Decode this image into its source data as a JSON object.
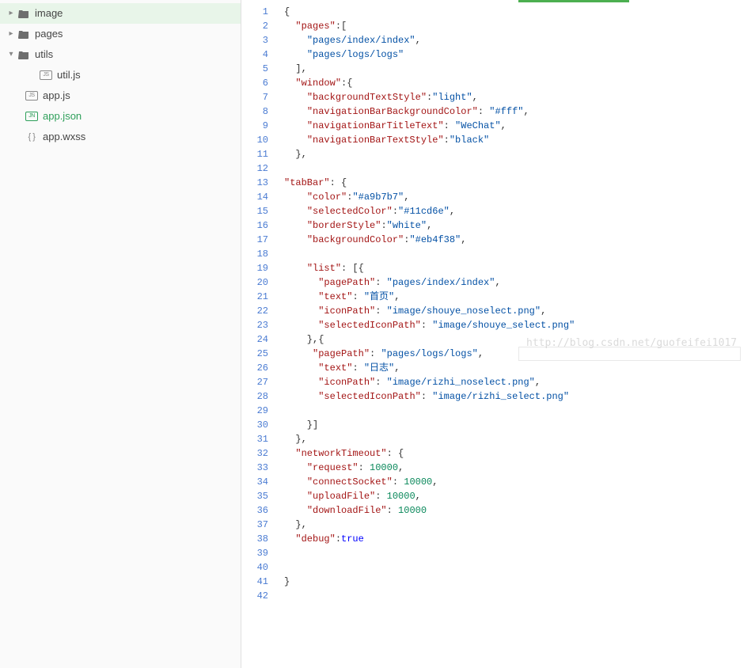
{
  "sidebar": {
    "items": [
      {
        "label": "image",
        "type": "folder",
        "indent": 0,
        "expanded": false
      },
      {
        "label": "pages",
        "type": "folder",
        "indent": 0,
        "expanded": false
      },
      {
        "label": "utils",
        "type": "folder",
        "indent": 0,
        "expanded": true
      },
      {
        "label": "util.js",
        "type": "js",
        "indent": 1
      },
      {
        "label": "app.js",
        "type": "js",
        "indent": 0
      },
      {
        "label": "app.json",
        "type": "json",
        "indent": 0,
        "active": true
      },
      {
        "label": "app.wxss",
        "type": "wxss",
        "indent": 0
      }
    ]
  },
  "watermark": "http://blog.csdn.net/guofeifei1017",
  "code": {
    "lines": [
      [
        [
          "brace",
          "{"
        ]
      ],
      [
        [
          "punct",
          "  "
        ],
        [
          "key",
          "\"pages\""
        ],
        [
          "punct",
          ":["
        ]
      ],
      [
        [
          "punct",
          "    "
        ],
        [
          "str",
          "\"pages/index/index\""
        ],
        [
          "punct",
          ","
        ]
      ],
      [
        [
          "punct",
          "    "
        ],
        [
          "str",
          "\"pages/logs/logs\""
        ]
      ],
      [
        [
          "punct",
          "  ],"
        ]
      ],
      [
        [
          "punct",
          "  "
        ],
        [
          "key",
          "\"window\""
        ],
        [
          "punct",
          ":{"
        ]
      ],
      [
        [
          "punct",
          "    "
        ],
        [
          "key",
          "\"backgroundTextStyle\""
        ],
        [
          "punct",
          ":"
        ],
        [
          "str",
          "\"light\""
        ],
        [
          "punct",
          ","
        ]
      ],
      [
        [
          "punct",
          "    "
        ],
        [
          "key",
          "\"navigationBarBackgroundColor\""
        ],
        [
          "punct",
          ": "
        ],
        [
          "str",
          "\"#fff\""
        ],
        [
          "punct",
          ","
        ]
      ],
      [
        [
          "punct",
          "    "
        ],
        [
          "key",
          "\"navigationBarTitleText\""
        ],
        [
          "punct",
          ": "
        ],
        [
          "str",
          "\"WeChat\""
        ],
        [
          "punct",
          ","
        ]
      ],
      [
        [
          "punct",
          "    "
        ],
        [
          "key",
          "\"navigationBarTextStyle\""
        ],
        [
          "punct",
          ":"
        ],
        [
          "str",
          "\"black\""
        ]
      ],
      [
        [
          "punct",
          "  },"
        ]
      ],
      [],
      [
        [
          "key",
          "\"tabBar\""
        ],
        [
          "punct",
          ": {"
        ]
      ],
      [
        [
          "punct",
          "    "
        ],
        [
          "key",
          "\"color\""
        ],
        [
          "punct",
          ":"
        ],
        [
          "str",
          "\"#a9b7b7\""
        ],
        [
          "punct",
          ","
        ]
      ],
      [
        [
          "punct",
          "    "
        ],
        [
          "key",
          "\"selectedColor\""
        ],
        [
          "punct",
          ":"
        ],
        [
          "str",
          "\"#11cd6e\""
        ],
        [
          "punct",
          ","
        ]
      ],
      [
        [
          "punct",
          "    "
        ],
        [
          "key",
          "\"borderStyle\""
        ],
        [
          "punct",
          ":"
        ],
        [
          "str",
          "\"white\""
        ],
        [
          "punct",
          ","
        ]
      ],
      [
        [
          "punct",
          "    "
        ],
        [
          "key",
          "\"backgroundColor\""
        ],
        [
          "punct",
          ":"
        ],
        [
          "str",
          "\"#eb4f38\""
        ],
        [
          "punct",
          ","
        ]
      ],
      [],
      [
        [
          "punct",
          "    "
        ],
        [
          "key",
          "\"list\""
        ],
        [
          "punct",
          ": [{"
        ]
      ],
      [
        [
          "punct",
          "      "
        ],
        [
          "key",
          "\"pagePath\""
        ],
        [
          "punct",
          ": "
        ],
        [
          "str",
          "\"pages/index/index\""
        ],
        [
          "punct",
          ","
        ]
      ],
      [
        [
          "punct",
          "      "
        ],
        [
          "key",
          "\"text\""
        ],
        [
          "punct",
          ": "
        ],
        [
          "str",
          "\"首页\""
        ],
        [
          "punct",
          ","
        ]
      ],
      [
        [
          "punct",
          "      "
        ],
        [
          "key",
          "\"iconPath\""
        ],
        [
          "punct",
          ": "
        ],
        [
          "str",
          "\"image/shouye_noselect.png\""
        ],
        [
          "punct",
          ","
        ]
      ],
      [
        [
          "punct",
          "      "
        ],
        [
          "key",
          "\"selectedIconPath\""
        ],
        [
          "punct",
          ": "
        ],
        [
          "str",
          "\"image/shouye_select.png\""
        ]
      ],
      [
        [
          "punct",
          "    },{"
        ]
      ],
      [
        [
          "punct",
          "     "
        ],
        [
          "key",
          "\"pagePath\""
        ],
        [
          "punct",
          ": "
        ],
        [
          "str",
          "\"pages/logs/logs\""
        ],
        [
          "punct",
          ","
        ]
      ],
      [
        [
          "punct",
          "      "
        ],
        [
          "key",
          "\"text\""
        ],
        [
          "punct",
          ": "
        ],
        [
          "str",
          "\"日志\""
        ],
        [
          "punct",
          ","
        ]
      ],
      [
        [
          "punct",
          "      "
        ],
        [
          "key",
          "\"iconPath\""
        ],
        [
          "punct",
          ": "
        ],
        [
          "str",
          "\"image/rizhi_noselect.png\""
        ],
        [
          "punct",
          ","
        ]
      ],
      [
        [
          "punct",
          "      "
        ],
        [
          "key",
          "\"selectedIconPath\""
        ],
        [
          "punct",
          ": "
        ],
        [
          "str",
          "\"image/rizhi_select.png\""
        ]
      ],
      [],
      [
        [
          "punct",
          "    }]"
        ]
      ],
      [
        [
          "punct",
          "  },"
        ]
      ],
      [
        [
          "punct",
          "  "
        ],
        [
          "key",
          "\"networkTimeout\""
        ],
        [
          "punct",
          ": {"
        ]
      ],
      [
        [
          "punct",
          "    "
        ],
        [
          "key",
          "\"request\""
        ],
        [
          "punct",
          ": "
        ],
        [
          "num",
          "10000"
        ],
        [
          "punct",
          ","
        ]
      ],
      [
        [
          "punct",
          "    "
        ],
        [
          "key",
          "\"connectSocket\""
        ],
        [
          "punct",
          ": "
        ],
        [
          "num",
          "10000"
        ],
        [
          "punct",
          ","
        ]
      ],
      [
        [
          "punct",
          "    "
        ],
        [
          "key",
          "\"uploadFile\""
        ],
        [
          "punct",
          ": "
        ],
        [
          "num",
          "10000"
        ],
        [
          "punct",
          ","
        ]
      ],
      [
        [
          "punct",
          "    "
        ],
        [
          "key",
          "\"downloadFile\""
        ],
        [
          "punct",
          ": "
        ],
        [
          "num",
          "10000"
        ]
      ],
      [
        [
          "punct",
          "  },"
        ]
      ],
      [
        [
          "punct",
          "  "
        ],
        [
          "key",
          "\"debug\""
        ],
        [
          "punct",
          ":"
        ],
        [
          "bool",
          "true"
        ]
      ],
      [],
      [],
      [
        [
          "brace",
          "}"
        ]
      ],
      []
    ]
  }
}
